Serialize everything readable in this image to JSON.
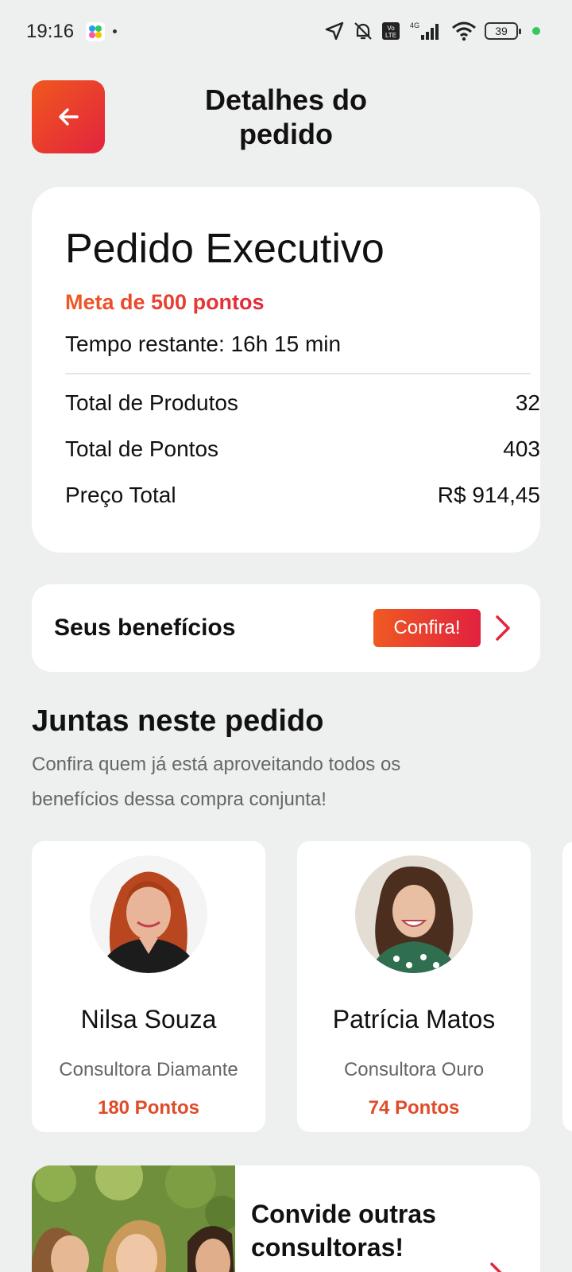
{
  "status_bar": {
    "time": "19:16",
    "network": "4G",
    "volte": "Vo LTE",
    "battery": "39"
  },
  "header": {
    "title": "Detalhes do pedido",
    "back_icon": "arrow-left-icon"
  },
  "order": {
    "name": "Pedido Executivo",
    "goal": "Meta de 500 pontos",
    "time_remaining": "Tempo restante: 16h 15 min",
    "rows": [
      {
        "label": "Total de Produtos",
        "value": "32"
      },
      {
        "label": "Total de Pontos",
        "value": "403"
      },
      {
        "label": "Preço Total",
        "value": "R$ 914,45"
      }
    ]
  },
  "benefits": {
    "label": "Seus benefícios",
    "button": "Confira!"
  },
  "participants": {
    "title": "Juntas neste pedido",
    "subtitle": "Confira quem já está aproveitando todos os benefícios dessa compra conjunta!",
    "people": [
      {
        "name": "Nilsa Souza",
        "role": "Consultora Diamante",
        "points": "180 Pontos"
      },
      {
        "name": "Patrícia Matos",
        "role": "Consultora Ouro",
        "points": "74 Pontos"
      }
    ]
  },
  "invite": {
    "text": "Convide outras consultoras!"
  },
  "colors": {
    "accent_start": "#ef5a22",
    "accent_end": "#e2213f",
    "background": "#eef0ef",
    "card": "#ffffff"
  }
}
